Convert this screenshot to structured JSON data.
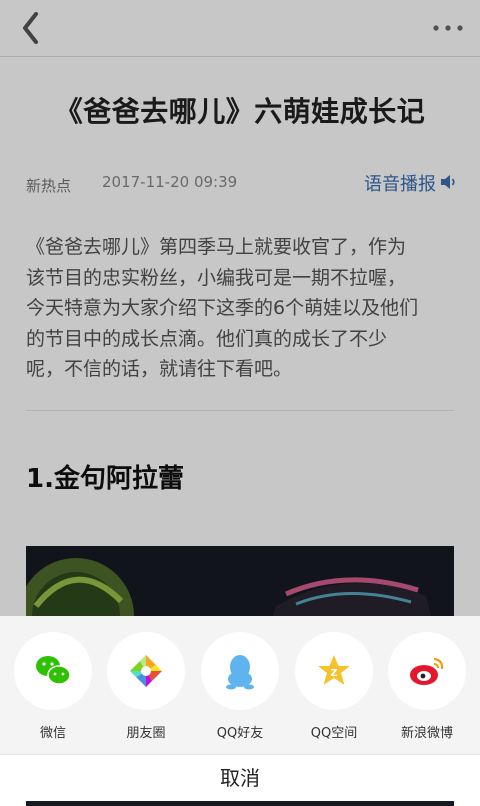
{
  "header": {
    "back_icon": "chevron-left-icon",
    "more_icon": "more-dots-icon"
  },
  "article": {
    "title": "《爸爸去哪儿》六萌娃成长记",
    "source": "新热点",
    "datetime": "2017-11-20 09:39",
    "tts_label": "语音播报",
    "tts_icon": "speaker-icon",
    "intro_lines": [
      "《爸爸去哪儿》第四季马上就要收官了，作为",
      "该节目的忠实粉丝，小编我可是一期不拉喔，",
      "今天特意为大家介绍下这季的6个萌娃以及他们",
      "的节目中的成长点滴。他们真的成长了不少",
      "呢，不信的话，就请往下看吧。"
    ],
    "section_heading": "1.金句阿拉蕾"
  },
  "share_sheet": {
    "items": [
      {
        "label": "微信",
        "icon": "wechat-icon",
        "color": "#2dc100"
      },
      {
        "label": "朋友圈",
        "icon": "moments-icon",
        "color": "#f5a623"
      },
      {
        "label": "QQ好友",
        "icon": "qq-icon",
        "color": "#5fb4f0"
      },
      {
        "label": "QQ空间",
        "icon": "qzone-icon",
        "color": "#f7c12b"
      },
      {
        "label": "新浪微博",
        "icon": "weibo-icon",
        "color": "#e6162d"
      }
    ],
    "cancel_label": "取消"
  },
  "colors": {
    "link_blue": "#3b6fb3",
    "overlay": "rgba(0,0,0,0.22)"
  }
}
